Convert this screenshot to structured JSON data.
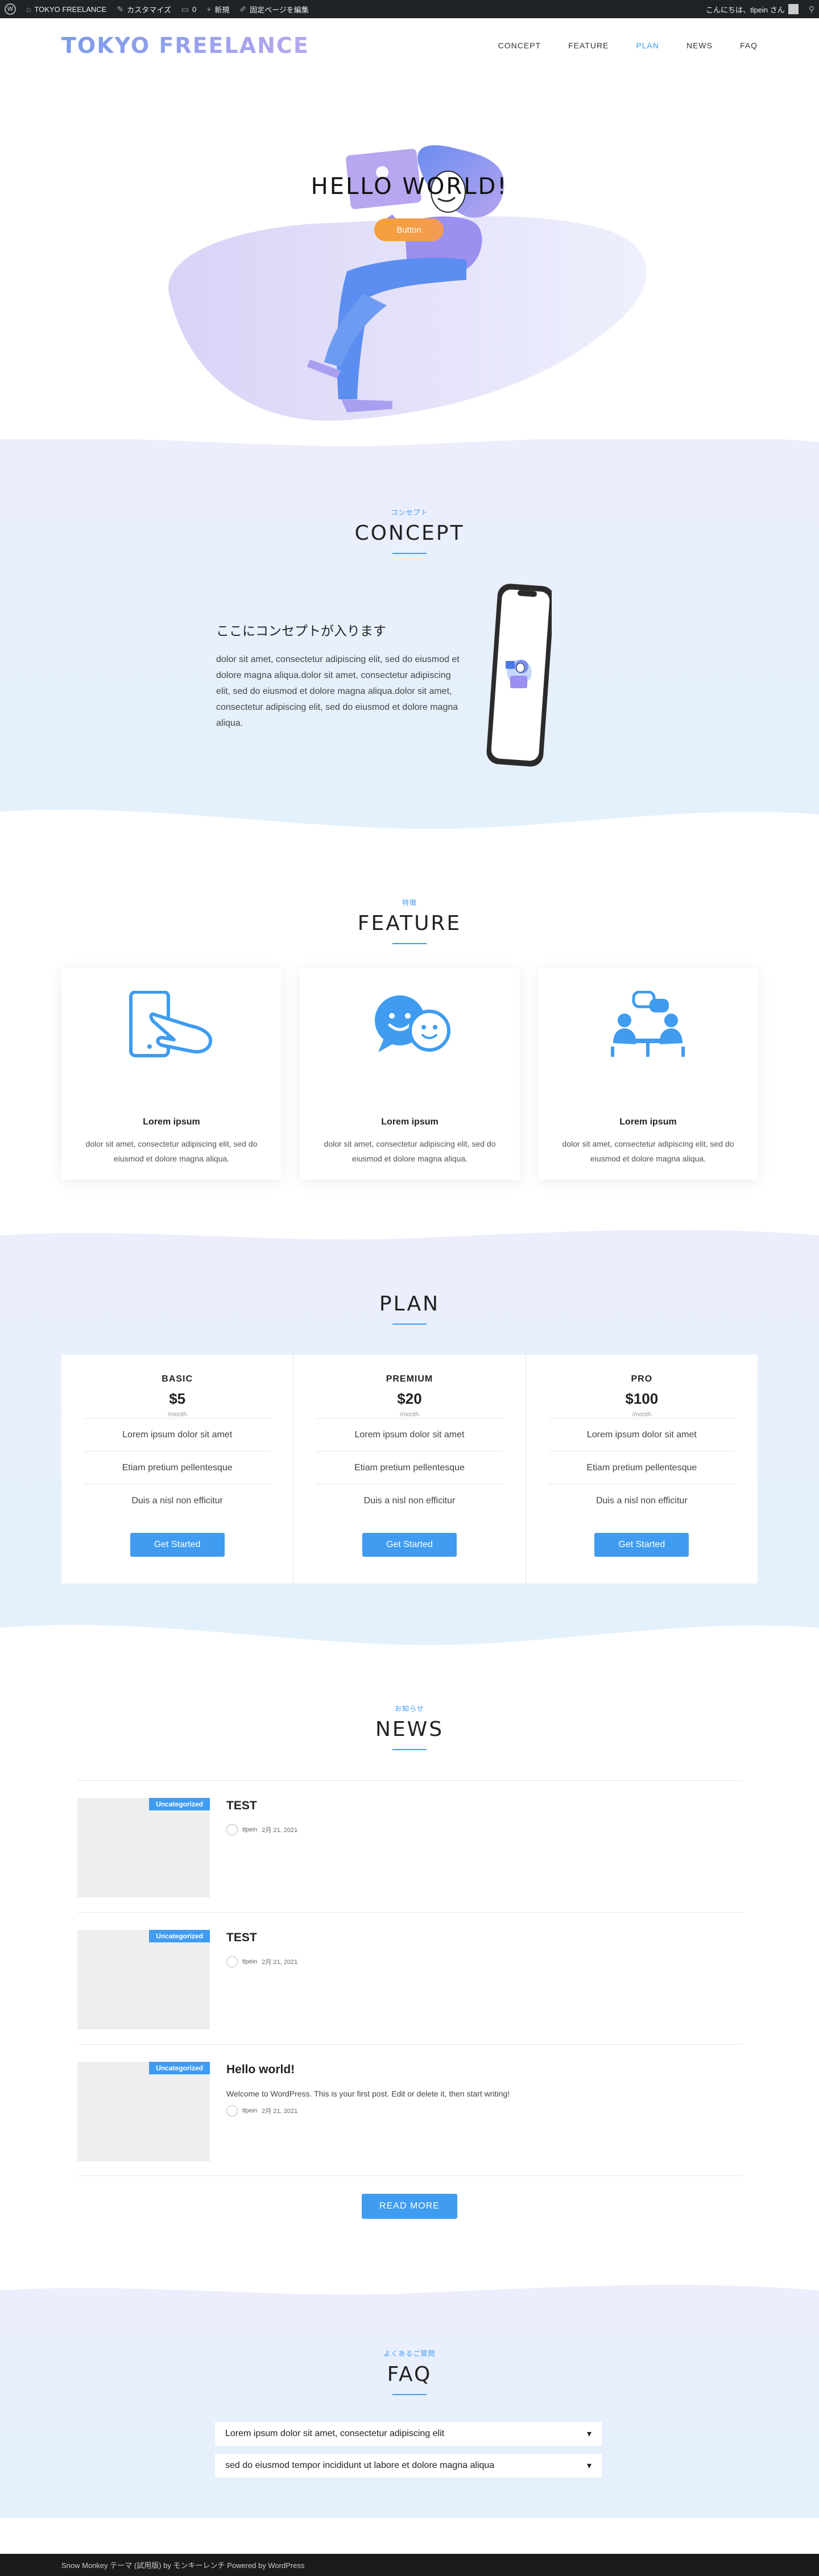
{
  "adminbar": {
    "site_name": "TOKYO FREELANCE",
    "customize": "カスタマイズ",
    "comments_count": "0",
    "new": "新規",
    "edit_page": "固定ページを編集",
    "greeting": "こんにちは、tlpein さん"
  },
  "header": {
    "logo": "TOKYO FREELANCE",
    "nav": [
      "CONCEPT",
      "FEATURE",
      "PLAN",
      "NEWS",
      "FAQ"
    ],
    "active_nav": "PLAN"
  },
  "hero": {
    "title": "HELLO WORLD!",
    "button": "Button"
  },
  "concept": {
    "eyebrow": "コンセプト",
    "title": "CONCEPT",
    "heading": "ここにコンセプトが入ります",
    "body": "dolor sit amet, consectetur adipiscing elit, sed do eiusmod et dolore magna aliqua.dolor sit amet, consectetur adipiscing elit, sed do eiusmod et dolore magna aliqua.dolor sit amet, consectetur adipiscing elit, sed do eiusmod et dolore magna aliqua."
  },
  "feature": {
    "eyebrow": "特徴",
    "title": "FEATURE",
    "cards": [
      {
        "icon": "phone-touch-icon",
        "title": "Lorem ipsum",
        "text": "dolor sit amet, consectetur adipiscing elit, sed do eiusmod et dolore magna aliqua."
      },
      {
        "icon": "chat-bubbles-icon",
        "title": "Lorem ipsum",
        "text": "dolor sit amet, consectetur adipiscing elit, sed do eiusmod et dolore magna aliqua."
      },
      {
        "icon": "meeting-icon",
        "title": "Lorem ipsum",
        "text": "dolor sit amet, consectetur adipiscing elit, sed do eiusmod et dolore magna aliqua."
      }
    ]
  },
  "plan": {
    "title": "PLAN",
    "plans": [
      {
        "name": "BASIC",
        "price": "$5",
        "per": "/month",
        "items": [
          "Lorem ipsum dolor sit amet",
          "Etiam pretium pellentesque",
          "Duis a nisl non efficitur"
        ],
        "button": "Get Started"
      },
      {
        "name": "PREMIUM",
        "price": "$20",
        "per": "/month",
        "items": [
          "Lorem ipsum dolor sit amet",
          "Etiam pretium pellentesque",
          "Duis a nisl non efficitur"
        ],
        "button": "Get Started"
      },
      {
        "name": "PRO",
        "price": "$100",
        "per": "/month",
        "items": [
          "Lorem ipsum dolor sit amet",
          "Etiam pretium pellentesque",
          "Duis a nisl non efficitur"
        ],
        "button": "Get Started"
      }
    ]
  },
  "news": {
    "eyebrow": "お知らせ",
    "title": "NEWS",
    "items": [
      {
        "category": "Uncategorized",
        "title": "TEST",
        "excerpt": "",
        "author": "tlpein",
        "date": "2月 21, 2021"
      },
      {
        "category": "Uncategorized",
        "title": "TEST",
        "excerpt": "",
        "author": "tlpein",
        "date": "2月 21, 2021"
      },
      {
        "category": "Uncategorized",
        "title": "Hello world!",
        "excerpt": "Welcome to WordPress. This is your first post. Edit or delete it, then start writing!",
        "author": "tlpein",
        "date": "2月 21, 2021"
      }
    ],
    "read_more": "READ MORE"
  },
  "faq": {
    "eyebrow": "よくあるご質問",
    "title": "FAQ",
    "questions": [
      "Lorem ipsum dolor sit amet, consectetur adipiscing elit",
      "sed do eiusmod tempor incididunt ut labore et dolore magna aliqua"
    ]
  },
  "footer": {
    "text": "Snow Monkey テーマ (試用版) by モンキーレンチ Powered by WordPress"
  },
  "colors": {
    "accent": "#3f9cf0",
    "orange": "#f5a03a",
    "purple": "#a99ff0",
    "light_bg": "#eceefd"
  }
}
